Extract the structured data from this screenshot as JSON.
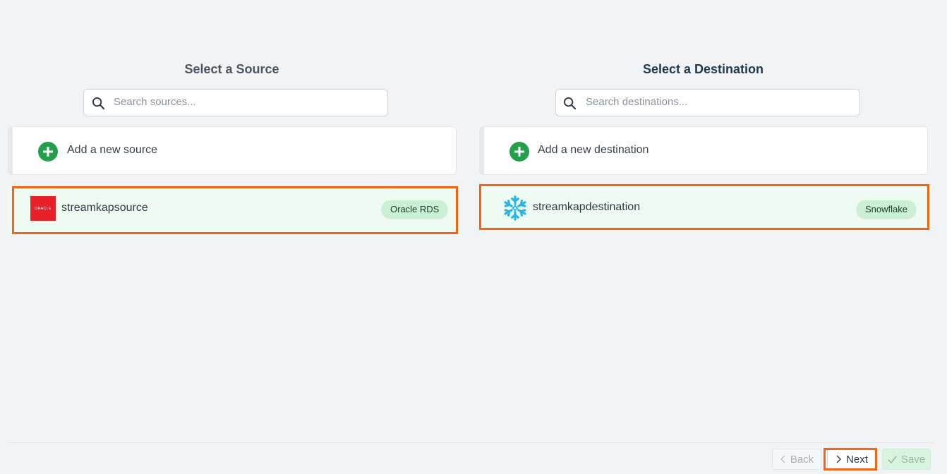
{
  "source": {
    "title": "Select a Source",
    "search_placeholder": "Search sources...",
    "add_label": "Add a new source",
    "item": {
      "name": "streamkapsource",
      "badge": "Oracle RDS",
      "logo_text": "ORACLE"
    }
  },
  "destination": {
    "title": "Select a Destination",
    "search_placeholder": "Search destinations...",
    "add_label": "Add a new destination",
    "item": {
      "name": "streamkapdestination",
      "badge": "Snowflake"
    }
  },
  "footer": {
    "back_label": "Back",
    "next_label": "Next",
    "save_label": "Save"
  },
  "colors": {
    "accent_green": "#22a04b",
    "highlight_orange": "#f26513",
    "oracle_red": "#e8202a",
    "snowflake_blue": "#29b5e8"
  },
  "icons": [
    "search-icon",
    "plus-circle-icon",
    "oracle-logo",
    "snowflake-icon",
    "chevron-left-icon",
    "chevron-right-icon",
    "check-icon"
  ]
}
